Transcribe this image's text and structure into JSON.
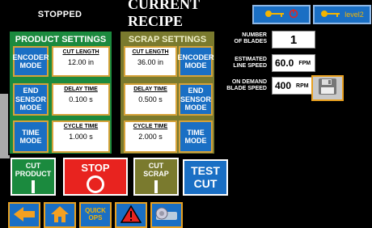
{
  "top": {
    "status": "STOPPED",
    "title": "CURRENT RECIPE",
    "level_label": "level2"
  },
  "product_settings": {
    "title": "PRODUCT SETTINGS",
    "encoder_mode": "ENCODER MODE",
    "cut_length_label": "CUT LENGTH",
    "cut_length_value": "12.00 in",
    "end_sensor_mode": "END SENSOR MODE",
    "delay_time_label": "DELAY TIME",
    "delay_time_value": "0.100 s",
    "time_mode": "TIME MODE",
    "cycle_time_label": "CYCLE TIME",
    "cycle_time_value": "1.000 s"
  },
  "scrap_settings": {
    "title": "SCRAP SETTINGS",
    "cut_length_label": "CUT LENGTH",
    "cut_length_value": "36.00 in",
    "encoder_mode": "ENCODER MODE",
    "delay_time_label": "DELAY TIME",
    "delay_time_value": "0.500 s",
    "end_sensor_mode": "END SENSOR MODE",
    "cycle_time_label": "CYCLE TIME",
    "cycle_time_value": "2.000 s",
    "time_mode": "TIME MODE"
  },
  "params": {
    "blades_label_1": "NUMBER",
    "blades_label_2": "OF BLADES",
    "blades_value": "1",
    "line_speed_label_1": "ESTIMATED",
    "line_speed_label_2": "LINE SPEED",
    "line_speed_value": "60.0",
    "line_speed_unit": "FPM",
    "blade_speed_label_1": "ON DEMAND",
    "blade_speed_label_2": "BLADE SPEED",
    "blade_speed_value": "400",
    "blade_speed_unit": "RPM"
  },
  "actions": {
    "cut_product_1": "CUT",
    "cut_product_2": "PRODUCT",
    "stop": "STOP",
    "cut_scrap_1": "CUT",
    "cut_scrap_2": "SCRAP",
    "test_1": "TEST",
    "test_2": "CUT"
  },
  "nav": {
    "quick_ops_1": "QUICK",
    "quick_ops_2": "OPS"
  },
  "colors": {
    "product_green": "#1b8a3e",
    "scrap_olive": "#7a7a2e",
    "mode_blue": "#1a6fc4",
    "stop_red": "#e8231f",
    "border_gold": "#d6a23a"
  }
}
